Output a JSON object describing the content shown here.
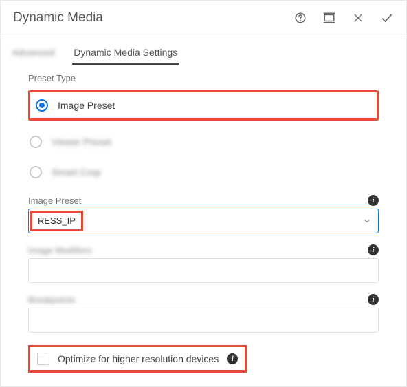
{
  "header": {
    "title": "Dynamic Media"
  },
  "tabs": {
    "tab1_label": "Advanced",
    "tab2_label": "Dynamic Media Settings"
  },
  "preset_type": {
    "label": "Preset Type",
    "options": {
      "image_preset": "Image Preset",
      "viewer_preset": "Viewer Preset",
      "smart_crop": "Smart Crop"
    }
  },
  "image_preset_field": {
    "label": "Image Preset",
    "value": "RESS_IP"
  },
  "image_modifiers_field": {
    "label": "Image Modifiers"
  },
  "breakpoints_field": {
    "label": "Breakpoints"
  },
  "optimize": {
    "label": "Optimize for higher resolution devices"
  },
  "info_glyph": "i"
}
